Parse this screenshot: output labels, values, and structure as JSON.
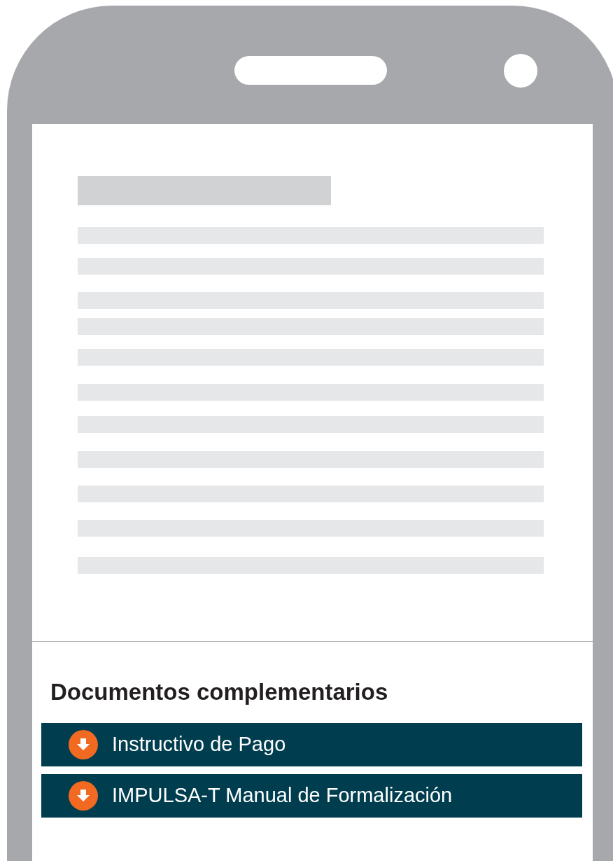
{
  "section": {
    "heading": "Documentos complementarios"
  },
  "documents": [
    {
      "label": "Instructivo de Pago"
    },
    {
      "label": "IMPULSA-T Manual de Formalización"
    }
  ]
}
